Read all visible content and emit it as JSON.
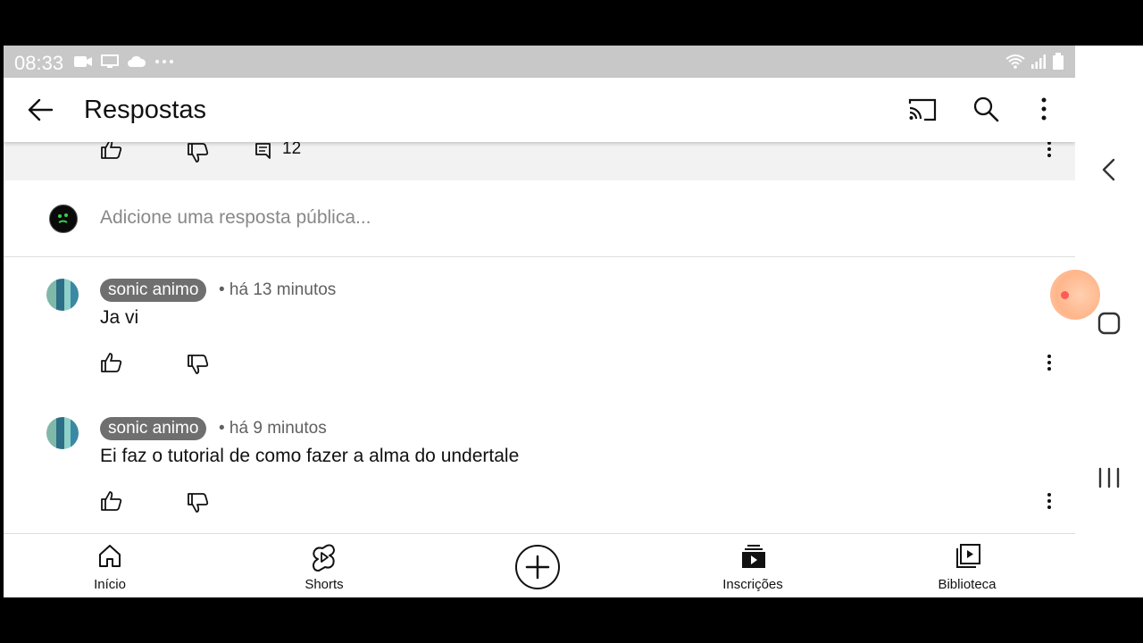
{
  "status_bar": {
    "time": "08:33"
  },
  "app_bar": {
    "title": "Respostas"
  },
  "parent_comment": {
    "reply_count": "12"
  },
  "reply_box": {
    "placeholder": "Adicione uma resposta pública..."
  },
  "replies": [
    {
      "author": "sonic animo",
      "time": "• há 13 minutos",
      "text": "Ja vi"
    },
    {
      "author": "sonic animo",
      "time": "• há 9 minutos",
      "text": "Ei faz o tutorial de como fazer a alma do undertale"
    }
  ],
  "bottom_nav": {
    "home": "Início",
    "shorts": "Shorts",
    "subscriptions": "Inscrições",
    "library": "Biblioteca"
  },
  "icons": {
    "back": "arrow-left-icon",
    "cast": "cast-icon",
    "search": "search-icon",
    "more": "more-vert-icon",
    "like": "thumb-up-icon",
    "dislike": "thumb-down-icon",
    "reply": "comment-icon",
    "home": "home-icon",
    "shorts": "shorts-icon",
    "create": "plus-circle-icon",
    "subscriptions": "subscriptions-icon",
    "library": "library-icon"
  },
  "colors": {
    "status_bar": "#c8c8c8",
    "author_chip": "#6f6f6f",
    "fab_dot": "#ff5a5a"
  }
}
